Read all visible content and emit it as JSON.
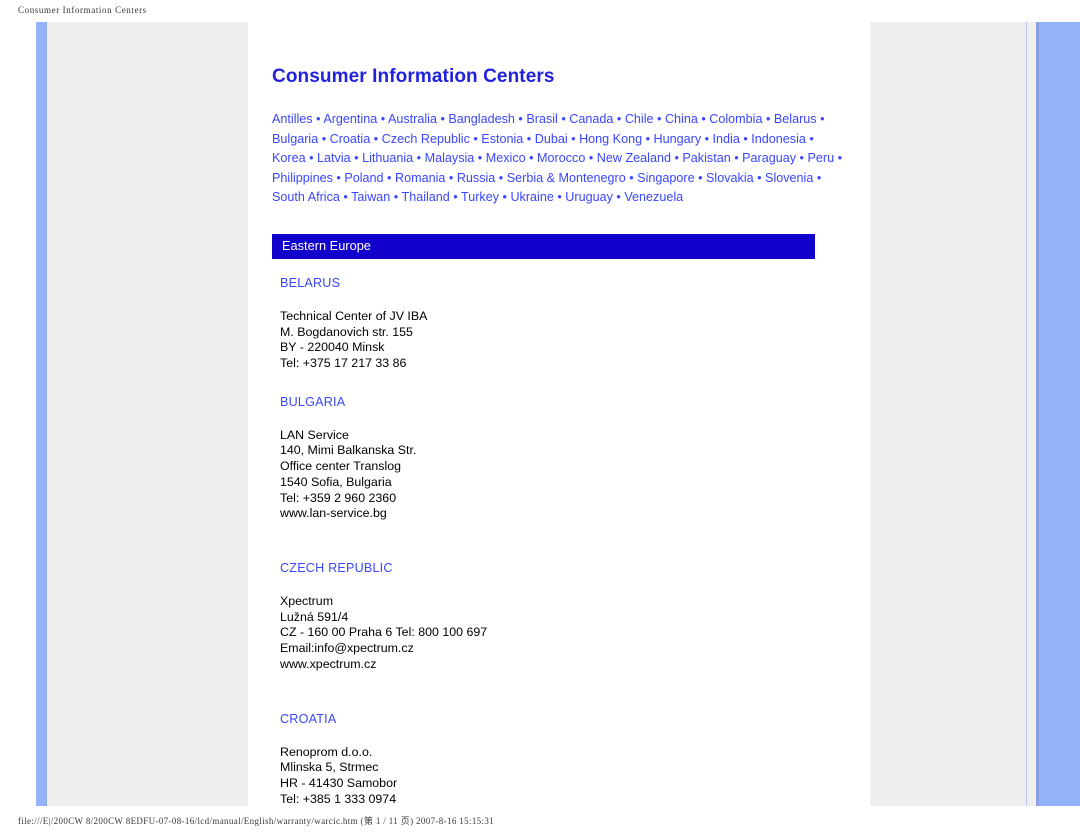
{
  "browser_chrome": {
    "header_title": "Consumer Information Centers",
    "footer_path": "file:///E|/200CW 8/200CW 8EDFU-07-08-16/lcd/manual/English/warranty/warcic.htm  (第 1 / 11 页) 2007-8-16 15:15:31"
  },
  "colors": {
    "link_blue": "#3a46ff",
    "title_blue": "#2222dd",
    "region_bar_bg": "#1100cc",
    "accent_bar": "#94b3fb",
    "panel_grey": "#efefef"
  },
  "document": {
    "title": "Consumer Information Centers",
    "country_links": [
      "Antilles",
      "Argentina",
      "Australia",
      "Bangladesh",
      "Brasil",
      "Canada",
      "Chile",
      "China",
      "Colombia",
      "Belarus",
      "Bulgaria",
      "Croatia",
      "Czech Republic",
      "Estonia",
      "Dubai",
      "Hong Kong",
      "Hungary",
      "India",
      "Indonesia",
      "Korea",
      "Latvia",
      "Lithuania",
      "Malaysia",
      "Mexico",
      "Morocco",
      "New Zealand",
      "Pakistan",
      "Paraguay",
      "Peru",
      "Philippines",
      "Poland",
      "Romania",
      "Russia",
      "Serbia & Montenegro",
      "Singapore",
      "Slovakia",
      "Slovenia",
      "South Africa",
      "Taiwan",
      "Thailand",
      "Turkey",
      "Ukraine",
      "Uruguay",
      "Venezuela"
    ],
    "link_separator": "•",
    "region_bar": "Eastern Europe",
    "entries": [
      {
        "country": "BELARUS",
        "address": "Technical Center of JV IBA\nM. Bogdanovich str. 155\nBY - 220040 Minsk\nTel: +375 17 217 33 86"
      },
      {
        "country": "BULGARIA",
        "address": "LAN Service\n140, Mimi Balkanska Str.\nOffice center Translog\n1540 Sofia, Bulgaria\nTel: +359 2 960 2360\nwww.lan-service.bg"
      },
      {
        "country": "CZECH REPUBLIC",
        "address": "Xpectrum\nLužná 591/4\nCZ - 160 00 Praha 6 Tel: 800 100 697\nEmail:info@xpectrum.cz\nwww.xpectrum.cz"
      },
      {
        "country": "CROATIA",
        "address": "Renoprom d.o.o.\nMlinska 5, Strmec\nHR - 41430 Samobor\nTel: +385 1 333 0974"
      }
    ]
  }
}
